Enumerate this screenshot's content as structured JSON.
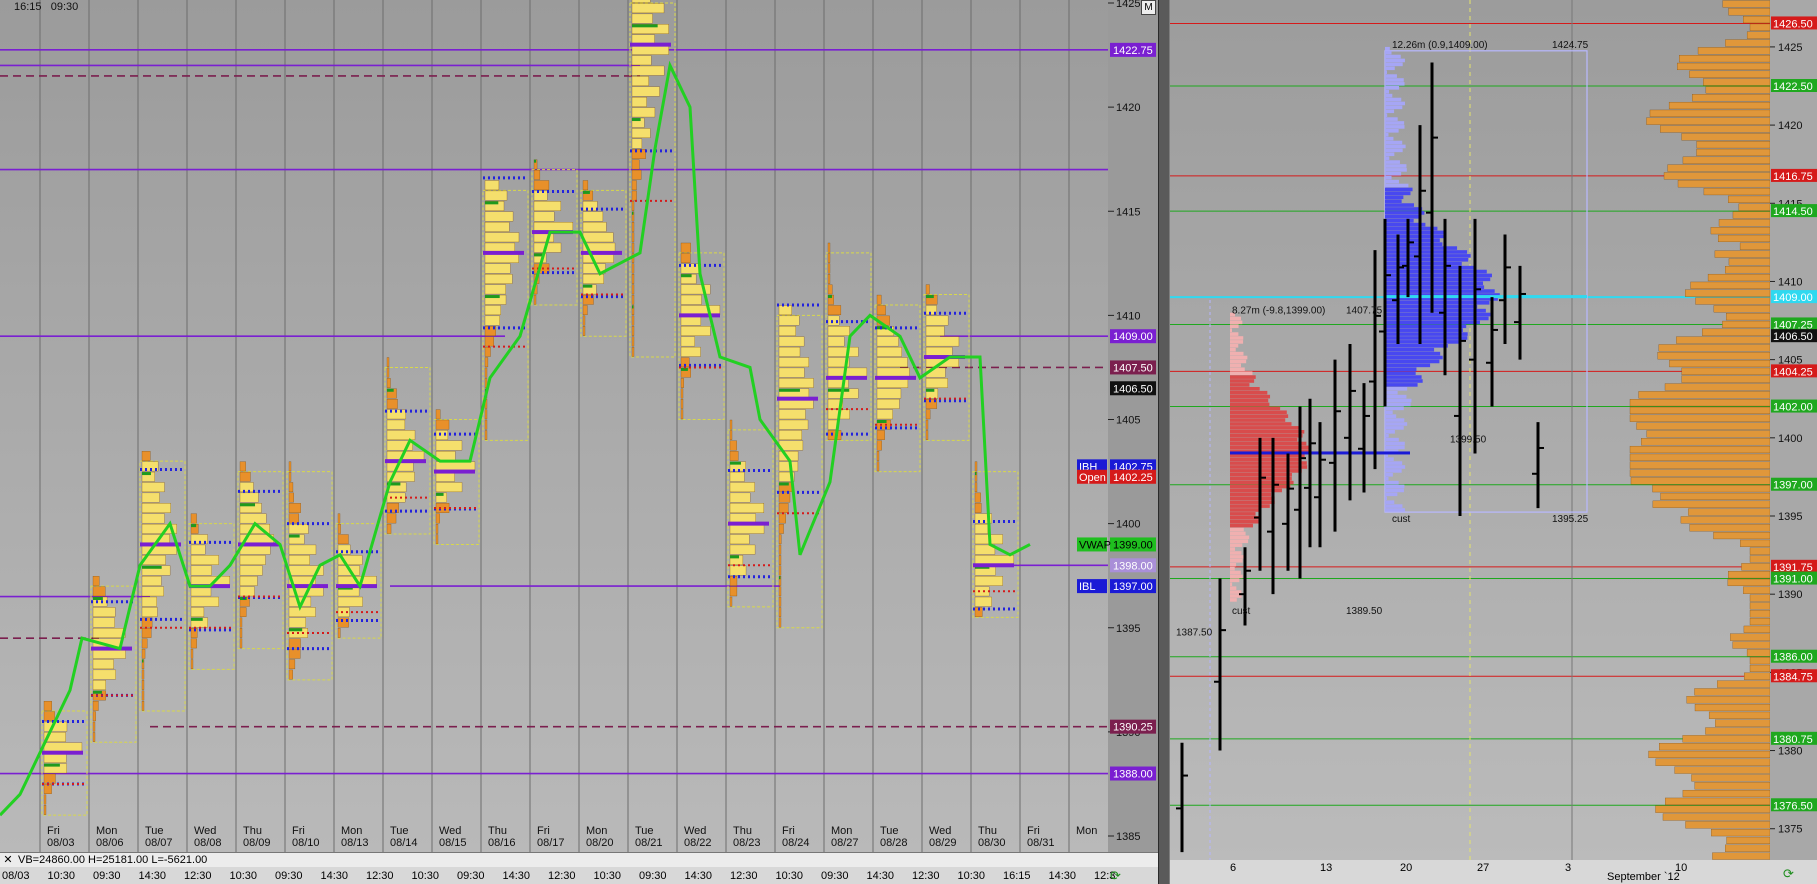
{
  "header": {
    "time_a": "16:15",
    "time_b": "09:30",
    "m_button": "M"
  },
  "toolbar": {
    "close": "✕",
    "stats": "VB=24860.00 H=25181.00 L=-5621.00"
  },
  "left_chart": {
    "price_axis": {
      "min": 1385,
      "max": 1425,
      "ticks": [
        1385,
        1390,
        1395,
        1400,
        1405,
        1410,
        1415,
        1420,
        1425
      ]
    },
    "day_labels": [
      {
        "d": "Fri",
        "dt": "08/03"
      },
      {
        "d": "Mon",
        "dt": "08/06"
      },
      {
        "d": "Tue",
        "dt": "08/07"
      },
      {
        "d": "Wed",
        "dt": "08/08"
      },
      {
        "d": "Thu",
        "dt": "08/09"
      },
      {
        "d": "Fri",
        "dt": "08/10"
      },
      {
        "d": "Mon",
        "dt": "08/13"
      },
      {
        "d": "Tue",
        "dt": "08/14"
      },
      {
        "d": "Wed",
        "dt": "08/15"
      },
      {
        "d": "Thu",
        "dt": "08/16"
      },
      {
        "d": "Fri",
        "dt": "08/17"
      },
      {
        "d": "Mon",
        "dt": "08/20"
      },
      {
        "d": "Tue",
        "dt": "08/21"
      },
      {
        "d": "Wed",
        "dt": "08/22"
      },
      {
        "d": "Thu",
        "dt": "08/23"
      },
      {
        "d": "Fri",
        "dt": "08/24"
      },
      {
        "d": "Mon",
        "dt": "08/27"
      },
      {
        "d": "Tue",
        "dt": "08/28"
      },
      {
        "d": "Wed",
        "dt": "08/29"
      },
      {
        "d": "Thu",
        "dt": "08/30"
      },
      {
        "d": "Fri",
        "dt": "08/31"
      },
      {
        "d": "Mon",
        "dt": ""
      }
    ],
    "time_labels": [
      "08/03",
      "10:30",
      "09:30",
      "14:30",
      "12:30",
      "10:30",
      "09:30",
      "14:30",
      "12:30",
      "10:30",
      "09:30",
      "14:30",
      "12:30",
      "10:30",
      "09:30",
      "14:30",
      "12:30",
      "10:30",
      "09:30",
      "14:30",
      "12:30",
      "10:30",
      "16:15",
      "14:30",
      "12:3"
    ],
    "level_tags": [
      {
        "text": "1422.75",
        "price": 1422.75,
        "bg": "#7a1fd1",
        "fg": "#ffffff"
      },
      {
        "text": "1409.00",
        "price": 1409.0,
        "bg": "#7a1fd1",
        "fg": "#ffffff"
      },
      {
        "text": "1407.50",
        "price": 1407.5,
        "bg": "#7b1f4e",
        "fg": "#ffffff"
      },
      {
        "text": "1406.50",
        "price": 1406.5,
        "bg": "#111111",
        "fg": "#ffffff"
      },
      {
        "text": "1402.75",
        "price": 1402.75,
        "bg": "#1a1ad6",
        "fg": "#ffffff",
        "side": "IBH"
      },
      {
        "text": "1402.25",
        "price": 1402.25,
        "bg": "#d51a1a",
        "fg": "#ffffff",
        "side": "Open"
      },
      {
        "text": "1399.00",
        "price": 1399.0,
        "bg": "#1fbf1f",
        "fg": "#000000",
        "side": "VWAP"
      },
      {
        "text": "1398.00",
        "price": 1398.0,
        "bg": "#a98fd8",
        "fg": "#ffffff"
      },
      {
        "text": "1397.00",
        "price": 1397.0,
        "bg": "#1a1ad6",
        "fg": "#ffffff",
        "side": "IBL"
      },
      {
        "text": "1390.25",
        "price": 1390.25,
        "bg": "#7b1f4e",
        "fg": "#ffffff"
      },
      {
        "text": "1388.00",
        "price": 1388.0,
        "bg": "#7a1fd1",
        "fg": "#ffffff"
      }
    ]
  },
  "right_chart": {
    "price_axis": {
      "min": 1373,
      "max": 1428,
      "ticks": [
        1375,
        1380,
        1385,
        1390,
        1395,
        1400,
        1405,
        1410,
        1415,
        1420,
        1425
      ]
    },
    "level_tags": [
      {
        "text": "1426.50",
        "price": 1426.5,
        "bg": "#d51a1a",
        "fg": "#ffffff"
      },
      {
        "text": "1422.50",
        "price": 1422.5,
        "bg": "#1fa81f",
        "fg": "#ffffff"
      },
      {
        "text": "1416.75",
        "price": 1416.75,
        "bg": "#d51a1a",
        "fg": "#ffffff"
      },
      {
        "text": "1414.50",
        "price": 1414.5,
        "bg": "#1fa81f",
        "fg": "#ffffff"
      },
      {
        "text": "1409.00",
        "price": 1409.0,
        "bg": "#2fd9f0",
        "fg": "#ffffff"
      },
      {
        "text": "1407.25",
        "price": 1407.25,
        "bg": "#1fa81f",
        "fg": "#ffffff"
      },
      {
        "text": "1406.50",
        "price": 1406.5,
        "bg": "#111111",
        "fg": "#ffffff"
      },
      {
        "text": "1404.25",
        "price": 1404.25,
        "bg": "#d51a1a",
        "fg": "#ffffff"
      },
      {
        "text": "1402.00",
        "price": 1402.0,
        "bg": "#1fa81f",
        "fg": "#ffffff"
      },
      {
        "text": "1397.00",
        "price": 1397.0,
        "bg": "#1fa81f",
        "fg": "#ffffff"
      },
      {
        "text": "1391.75",
        "price": 1391.75,
        "bg": "#d51a1a",
        "fg": "#ffffff"
      },
      {
        "text": "1391.00",
        "price": 1391.0,
        "bg": "#1fa81f",
        "fg": "#ffffff"
      },
      {
        "text": "1386.00",
        "price": 1386.0,
        "bg": "#1fa81f",
        "fg": "#ffffff"
      },
      {
        "text": "1384.75",
        "price": 1384.75,
        "bg": "#d51a1a",
        "fg": "#ffffff"
      },
      {
        "text": "1380.75",
        "price": 1380.75,
        "bg": "#1fa81f",
        "fg": "#ffffff"
      },
      {
        "text": "1376.50",
        "price": 1376.5,
        "bg": "#1fa81f",
        "fg": "#ffffff"
      }
    ],
    "annotations": {
      "box_top_left": "12.26m (0.9,1409.00)",
      "box_top_right": "1424.75",
      "box_mid": "1399.50",
      "box_bottom_left": "cust",
      "box_bottom_right": "1395.25",
      "prof2_top_left": "8.27m (-9.8,1399.00)",
      "prof2_top_right": "1407.75",
      "prof2_bottom_left": "cust",
      "prof2_bottom_right": "1389.50",
      "left_low": "1387.50"
    },
    "time_labels": [
      "6",
      "13",
      "20",
      "27",
      "3",
      "September `12",
      "10"
    ]
  },
  "colors": {
    "purple_line": "#7a1fd1",
    "green": "#1fa81f",
    "red": "#d51a1a",
    "blue": "#1a1ad6",
    "vwap": "#22d022",
    "orange": "#e8902a",
    "yellow": "#f5df6c"
  }
}
